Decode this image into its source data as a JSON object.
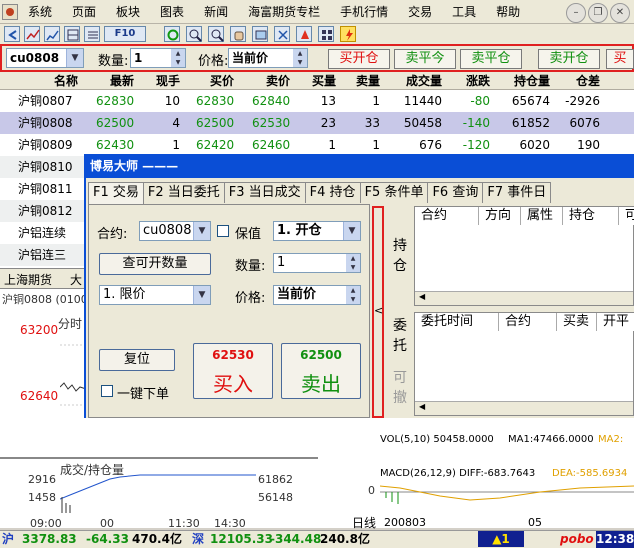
{
  "menu": [
    "系统",
    "页面",
    "板块",
    "图表",
    "新闻",
    "海富期货专栏",
    "手机行情",
    "交易",
    "工具",
    "帮助"
  ],
  "toolbar_icons": [
    "back-icon",
    "chart-icon",
    "zoom-in-icon",
    "zoom-out-icon",
    "list-icon",
    "function-icon",
    "refresh-icon",
    "draw-icon",
    "measure-icon",
    "hand-icon",
    "export-icon",
    "alarm-icon",
    "grid-icon",
    "lightning-icon"
  ],
  "orderbar": {
    "contract": "cu0808",
    "qty_label": "数量:",
    "qty": "1",
    "price_label": "价格:",
    "price": "当前价",
    "buttons": [
      {
        "label": "买开仓",
        "color": "red"
      },
      {
        "label": "卖平今",
        "color": "green"
      },
      {
        "label": "卖平仓",
        "color": "green"
      },
      {
        "label": "卖开仓",
        "color": "green"
      },
      {
        "label": "买",
        "color": "red"
      }
    ]
  },
  "quote": {
    "headers": [
      "名称",
      "最新",
      "现手",
      "买价",
      "卖价",
      "买量",
      "卖量",
      "成交量",
      "涨跌",
      "持仓量",
      "仓差"
    ],
    "rows": [
      {
        "name": "沪铜0807",
        "last": "62830",
        "vol": "10",
        "bid": "62830",
        "ask": "62840",
        "bidq": "13",
        "askq": "1",
        "total": "11440",
        "chg": "-80",
        "oi": "65674",
        "diff": "-2926"
      },
      {
        "name": "沪铜0808",
        "last": "62500",
        "vol": "4",
        "bid": "62500",
        "ask": "62530",
        "bidq": "23",
        "askq": "33",
        "total": "50458",
        "chg": "-140",
        "oi": "61852",
        "diff": "6076"
      },
      {
        "name": "沪铜0809",
        "last": "62430",
        "vol": "1",
        "bid": "62420",
        "ask": "62460",
        "bidq": "1",
        "askq": "1",
        "total": "676",
        "chg": "-120",
        "oi": "6020",
        "diff": "190"
      },
      {
        "name": "沪铜0810",
        "last": "",
        "vol": "",
        "bid": "",
        "ask": "",
        "bidq": "",
        "askq": "",
        "total": "",
        "chg": "",
        "oi": "",
        "diff": ""
      },
      {
        "name": "沪铜0811",
        "last": "",
        "vol": "",
        "bid": "",
        "ask": "",
        "bidq": "",
        "askq": "",
        "total": "",
        "chg": "",
        "oi": "",
        "diff": ""
      },
      {
        "name": "沪铜0812",
        "last": "",
        "vol": "",
        "bid": "",
        "ask": "",
        "bidq": "",
        "askq": "",
        "total": "",
        "chg": "",
        "oi": "",
        "diff": ""
      },
      {
        "name": "沪铝连续",
        "last": "",
        "vol": "",
        "bid": "",
        "ask": "",
        "bidq": "",
        "askq": "",
        "total": "",
        "chg": "",
        "oi": "",
        "diff": ""
      },
      {
        "name": "沪铝连三",
        "last": "",
        "vol": "",
        "bid": "",
        "ask": "",
        "bidq": "",
        "askq": "",
        "total": "",
        "chg": "",
        "oi": "",
        "diff": ""
      }
    ]
  },
  "left_tab": "上海期货",
  "left_tab2": "大",
  "chart_labels": {
    "symbol": "沪铜0808 (0100",
    "time_label": "分时",
    "price_hi": "63200",
    "price_lo": "62640",
    "vol_title": "成交/持仓量",
    "vol_hi": "2916",
    "vol_mid": "1458",
    "oi_hi": "61862",
    "oi_mid": "56148",
    "t1": "09:00",
    "t2": "11:30",
    "t3": "14:30",
    "t0": "00",
    "vol_indicator": "VOL(5,10) 50458.0000",
    "ma1": "MA1:47466.0000",
    "ma2": "MA2:",
    "macd": "MACD(26,12,9) DIFF:-683.7643",
    "dea": "DEA:-585.6934",
    "zero": "0",
    "kline_label": "日线",
    "date1": "200803",
    "date2": "05"
  },
  "dialog": {
    "title": "博易大师 ———",
    "tabs": [
      "F1 交易",
      "F2 当日委托",
      "F3 当日成交",
      "F4 持仓",
      "F5 条件单",
      "F6 查询",
      "F7 事件日"
    ],
    "contract_label": "合约:",
    "contract": "cu0808",
    "hedge_label": "保值",
    "open_close": "1. 开仓",
    "query_btn": "查可开数量",
    "qty_label": "数量:",
    "qty": "1",
    "order_type": "1. 限价",
    "price_label": "价格:",
    "price": "当前价",
    "reset_btn": "复位",
    "one_key": "一键下单",
    "buy_price": "62530",
    "buy_label": "买入",
    "sell_price": "62500",
    "sell_label": "卖出",
    "collapse_arrow": "<",
    "pos_tab": "持仓",
    "pos_headers": [
      "合约",
      "方向",
      "属性",
      "持仓",
      "可"
    ],
    "order_tab": "委托",
    "cancel_tab": "可撤",
    "order_headers": [
      "委托时间",
      "合约",
      "买卖",
      "开平"
    ]
  },
  "status": {
    "sh_label": "沪",
    "sh_index": "3378.83",
    "sh_chg": "-64.33",
    "sh_amt": "470.4亿",
    "sz_label": "深",
    "sz_index": "12105.33",
    "sz_chg": "-344.48",
    "sz_amt": "240.8亿",
    "alert": "▲1",
    "brand": "pobo",
    "time": "12:38"
  }
}
